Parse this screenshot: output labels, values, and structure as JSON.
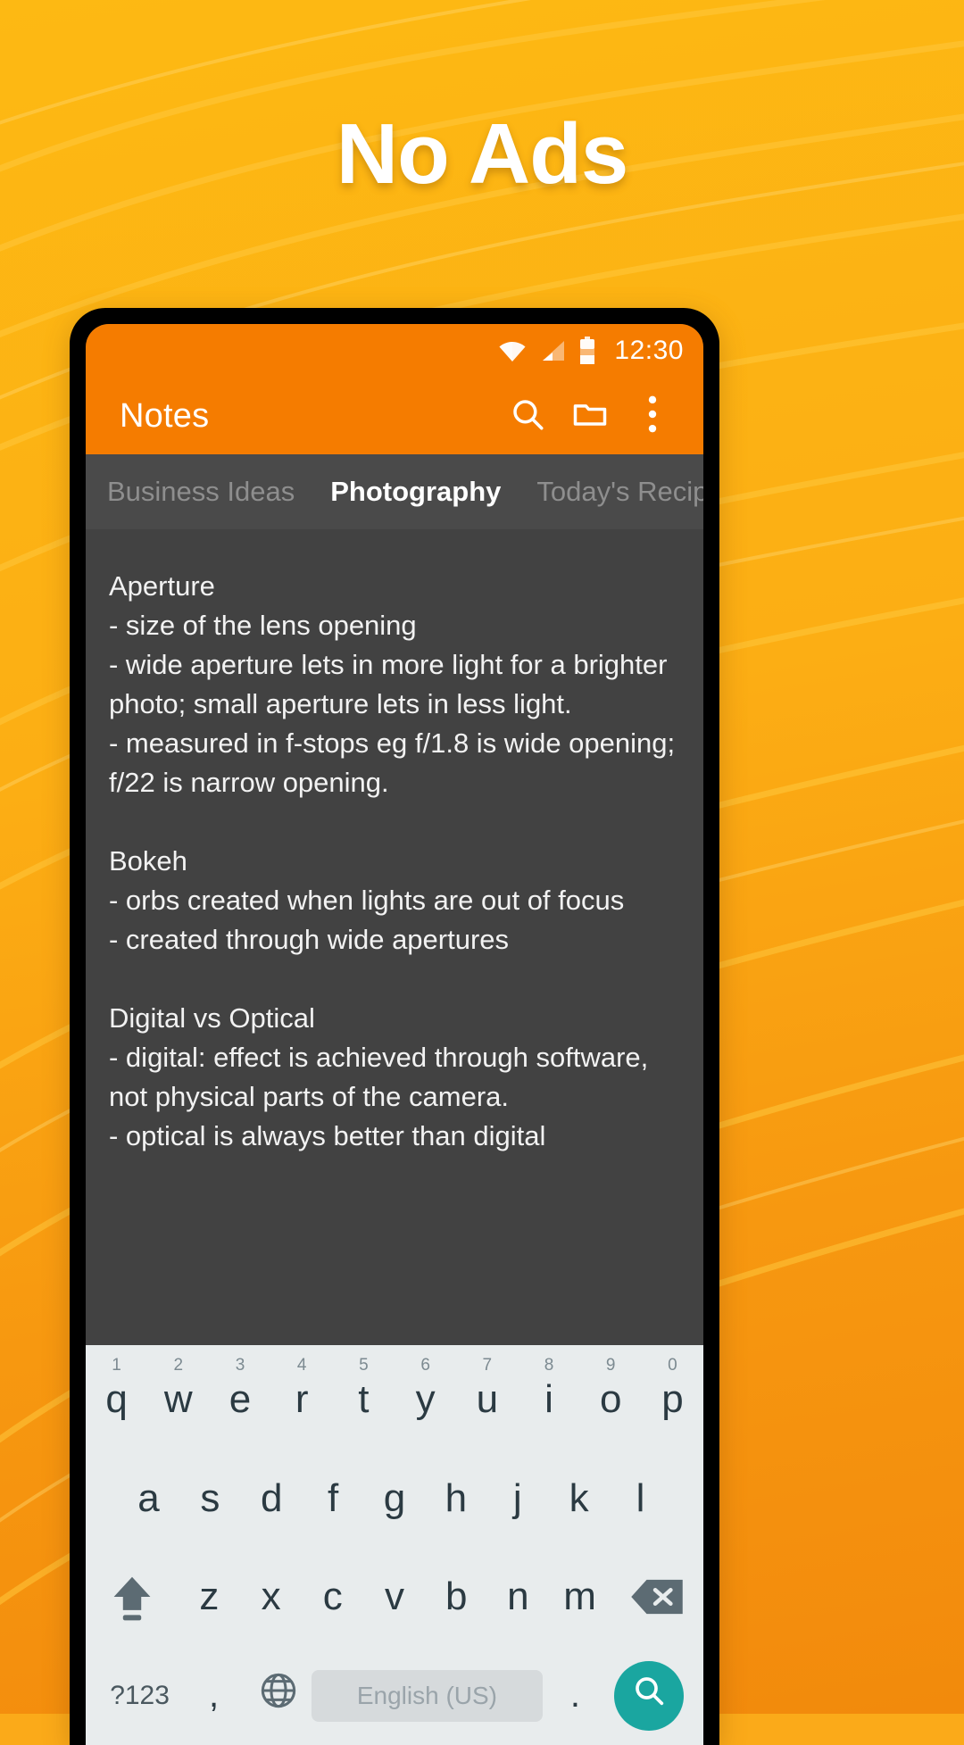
{
  "promo": {
    "headline": "No Ads",
    "background_color": "#FDB913",
    "headline_color": "#FFFFFF"
  },
  "phone": {
    "statusbar": {
      "time": "12:30",
      "icons": [
        "wifi-icon",
        "cellular-signal-icon",
        "battery-icon"
      ],
      "background_color": "#F57C00"
    },
    "appbar": {
      "title": "Notes",
      "background_color": "#F57C00",
      "actions": [
        {
          "name": "search-icon",
          "label": "Search"
        },
        {
          "name": "folder-icon",
          "label": "Folders"
        },
        {
          "name": "overflow-menu-icon",
          "label": "More options"
        }
      ]
    },
    "tabs": {
      "active_index": 1,
      "items": [
        {
          "label": "Business Ideas"
        },
        {
          "label": "Photography"
        },
        {
          "label": "Today's Recipe"
        }
      ]
    },
    "note": {
      "text": "Aperture\n- size of the lens opening\n- wide aperture lets in more light for a brighter photo; small aperture lets in less light.\n- measured in f-stops eg f/1.8 is wide opening; f/22 is narrow opening.\n\nBokeh\n- orbs created when lights are out of focus\n- created through wide apertures\n\nDigital vs Optical\n- digital: effect is achieved through software, not physical parts of the camera.\n- optical is always better than digital",
      "background_color": "#424242",
      "text_color": "#F2F2F2"
    },
    "keyboard": {
      "background_color": "#E8ECED",
      "row1": [
        {
          "letter": "q",
          "num": "1"
        },
        {
          "letter": "w",
          "num": "2"
        },
        {
          "letter": "e",
          "num": "3"
        },
        {
          "letter": "r",
          "num": "4"
        },
        {
          "letter": "t",
          "num": "5"
        },
        {
          "letter": "y",
          "num": "6"
        },
        {
          "letter": "u",
          "num": "7"
        },
        {
          "letter": "i",
          "num": "8"
        },
        {
          "letter": "o",
          "num": "9"
        },
        {
          "letter": "p",
          "num": "0"
        }
      ],
      "row2": [
        "a",
        "s",
        "d",
        "f",
        "g",
        "h",
        "j",
        "k",
        "l"
      ],
      "row3": [
        "z",
        "x",
        "c",
        "v",
        "b",
        "n",
        "m"
      ],
      "shift_key": "shift-icon",
      "backspace_key": "backspace-icon",
      "symbols_key": "?123",
      "comma_key": ",",
      "globe_key": "globe-icon",
      "space_key": "English (US)",
      "period_key": ".",
      "search_key": "search-icon",
      "search_key_color": "#1AA6A0"
    }
  }
}
